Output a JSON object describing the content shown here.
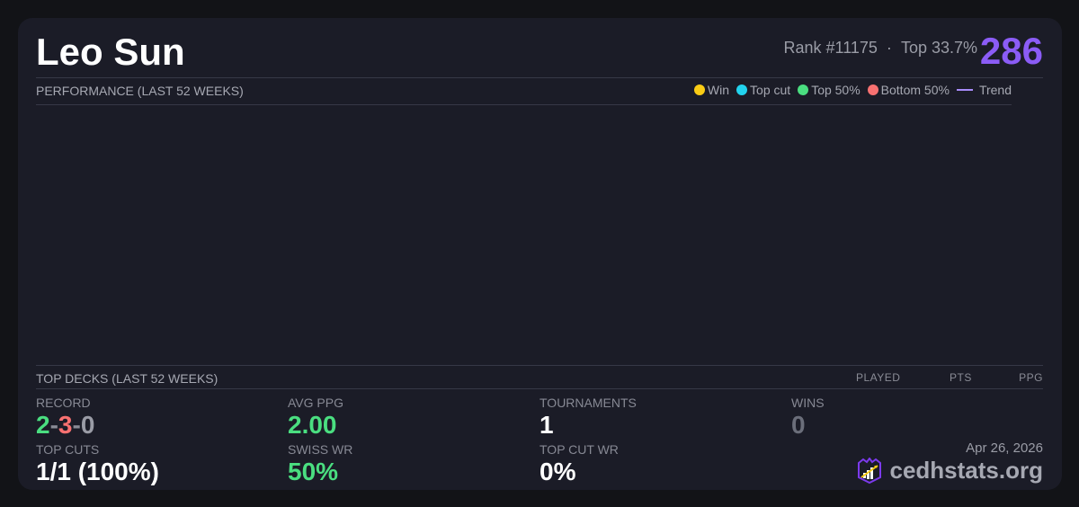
{
  "player": {
    "name": "Leo Sun",
    "rank": "Rank #11175",
    "sep": "·",
    "top": "Top 33.7%",
    "score": "286"
  },
  "performance": {
    "title": "PERFORMANCE (LAST 52 WEEKS)",
    "legend": [
      {
        "label": "Win",
        "color": "#facc15"
      },
      {
        "label": "Top cut",
        "color": "#22d3ee"
      },
      {
        "label": "Top 50%",
        "color": "#4ade80"
      },
      {
        "label": "Bottom 50%",
        "color": "#f87171"
      },
      {
        "label": "Trend",
        "color": "#a78bfa"
      }
    ]
  },
  "top_decks": {
    "title": "TOP DECKS (LAST 52 WEEKS)",
    "columns": [
      "PLAYED",
      "PTS",
      "PPG"
    ]
  },
  "stats": {
    "record": {
      "label": "RECORD",
      "wins": "2",
      "losses": "3",
      "draws": "0",
      "dash": "-"
    },
    "avg_ppg": {
      "label": "AVG PPG",
      "value": "2.00"
    },
    "tournaments": {
      "label": "TOURNAMENTS",
      "value": "1"
    },
    "wins": {
      "label": "WINS",
      "value": "0"
    },
    "top_cuts": {
      "label": "TOP CUTS",
      "value": "1/1 (100%)"
    },
    "swiss_wr": {
      "label": "SWISS WR",
      "value": "50%"
    },
    "top_cut_wr": {
      "label": "TOP CUT WR",
      "value": "0%"
    }
  },
  "footer": {
    "date": "Apr 26, 2026",
    "brand": "cedhstats.org"
  }
}
